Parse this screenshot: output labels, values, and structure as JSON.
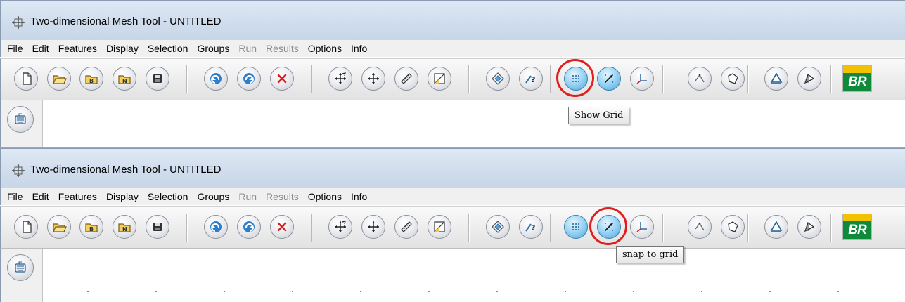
{
  "windows": [
    {
      "title": "Two-dimensional Mesh Tool - UNTITLED",
      "menu": [
        {
          "label": "File",
          "enabled": true
        },
        {
          "label": "Edit",
          "enabled": true
        },
        {
          "label": "Features",
          "enabled": true
        },
        {
          "label": "Display",
          "enabled": true
        },
        {
          "label": "Selection",
          "enabled": true
        },
        {
          "label": "Groups",
          "enabled": true
        },
        {
          "label": "Run",
          "enabled": false
        },
        {
          "label": "Results",
          "enabled": false
        },
        {
          "label": "Options",
          "enabled": true
        },
        {
          "label": "Info",
          "enabled": true
        }
      ],
      "tooltip": "Show Grid",
      "highlighted_button": "show-grid"
    },
    {
      "title": "Two-dimensional Mesh Tool - UNTITLED",
      "menu": [
        {
          "label": "File",
          "enabled": true
        },
        {
          "label": "Edit",
          "enabled": true
        },
        {
          "label": "Features",
          "enabled": true
        },
        {
          "label": "Display",
          "enabled": true
        },
        {
          "label": "Selection",
          "enabled": true
        },
        {
          "label": "Groups",
          "enabled": true
        },
        {
          "label": "Run",
          "enabled": false
        },
        {
          "label": "Results",
          "enabled": false
        },
        {
          "label": "Options",
          "enabled": true
        },
        {
          "label": "Info",
          "enabled": true
        }
      ],
      "tooltip": "snap to grid",
      "highlighted_button": "snap-to-grid"
    }
  ],
  "toolbar_buttons": [
    {
      "name": "new",
      "icon": "new-document-icon"
    },
    {
      "name": "open",
      "icon": "open-folder-icon"
    },
    {
      "name": "open-b",
      "icon": "open-folder-b-icon"
    },
    {
      "name": "open-n",
      "icon": "open-folder-n-icon"
    },
    {
      "name": "save",
      "icon": "save-disk-icon"
    },
    {
      "name": "undo",
      "icon": "undo-icon"
    },
    {
      "name": "redo",
      "icon": "redo-icon"
    },
    {
      "name": "delete",
      "icon": "delete-x-icon"
    },
    {
      "name": "zoom",
      "icon": "zoom-arrows-icon"
    },
    {
      "name": "pan",
      "icon": "pan-arrows-icon"
    },
    {
      "name": "measure",
      "icon": "ruler-icon"
    },
    {
      "name": "scale",
      "icon": "scale-icon"
    },
    {
      "name": "features",
      "icon": "diamond-layers-icon"
    },
    {
      "name": "query",
      "icon": "query-icon"
    },
    {
      "name": "show-grid",
      "icon": "grid-icon"
    },
    {
      "name": "snap-to-grid",
      "icon": "snap-grid-icon"
    },
    {
      "name": "axes",
      "icon": "axes-icon"
    },
    {
      "name": "edge",
      "icon": "edge-icon"
    },
    {
      "name": "region",
      "icon": "region-icon"
    },
    {
      "name": "triangle-mesh",
      "icon": "triangle-icon"
    },
    {
      "name": "mesh-generate",
      "icon": "mesh-generate-icon"
    }
  ],
  "logo_text": "BR",
  "colors": {
    "highlight": "#e01e1e",
    "active_button": "#4aa8dc",
    "logo_green": "#0f8a3a",
    "logo_yellow": "#f2c200"
  }
}
